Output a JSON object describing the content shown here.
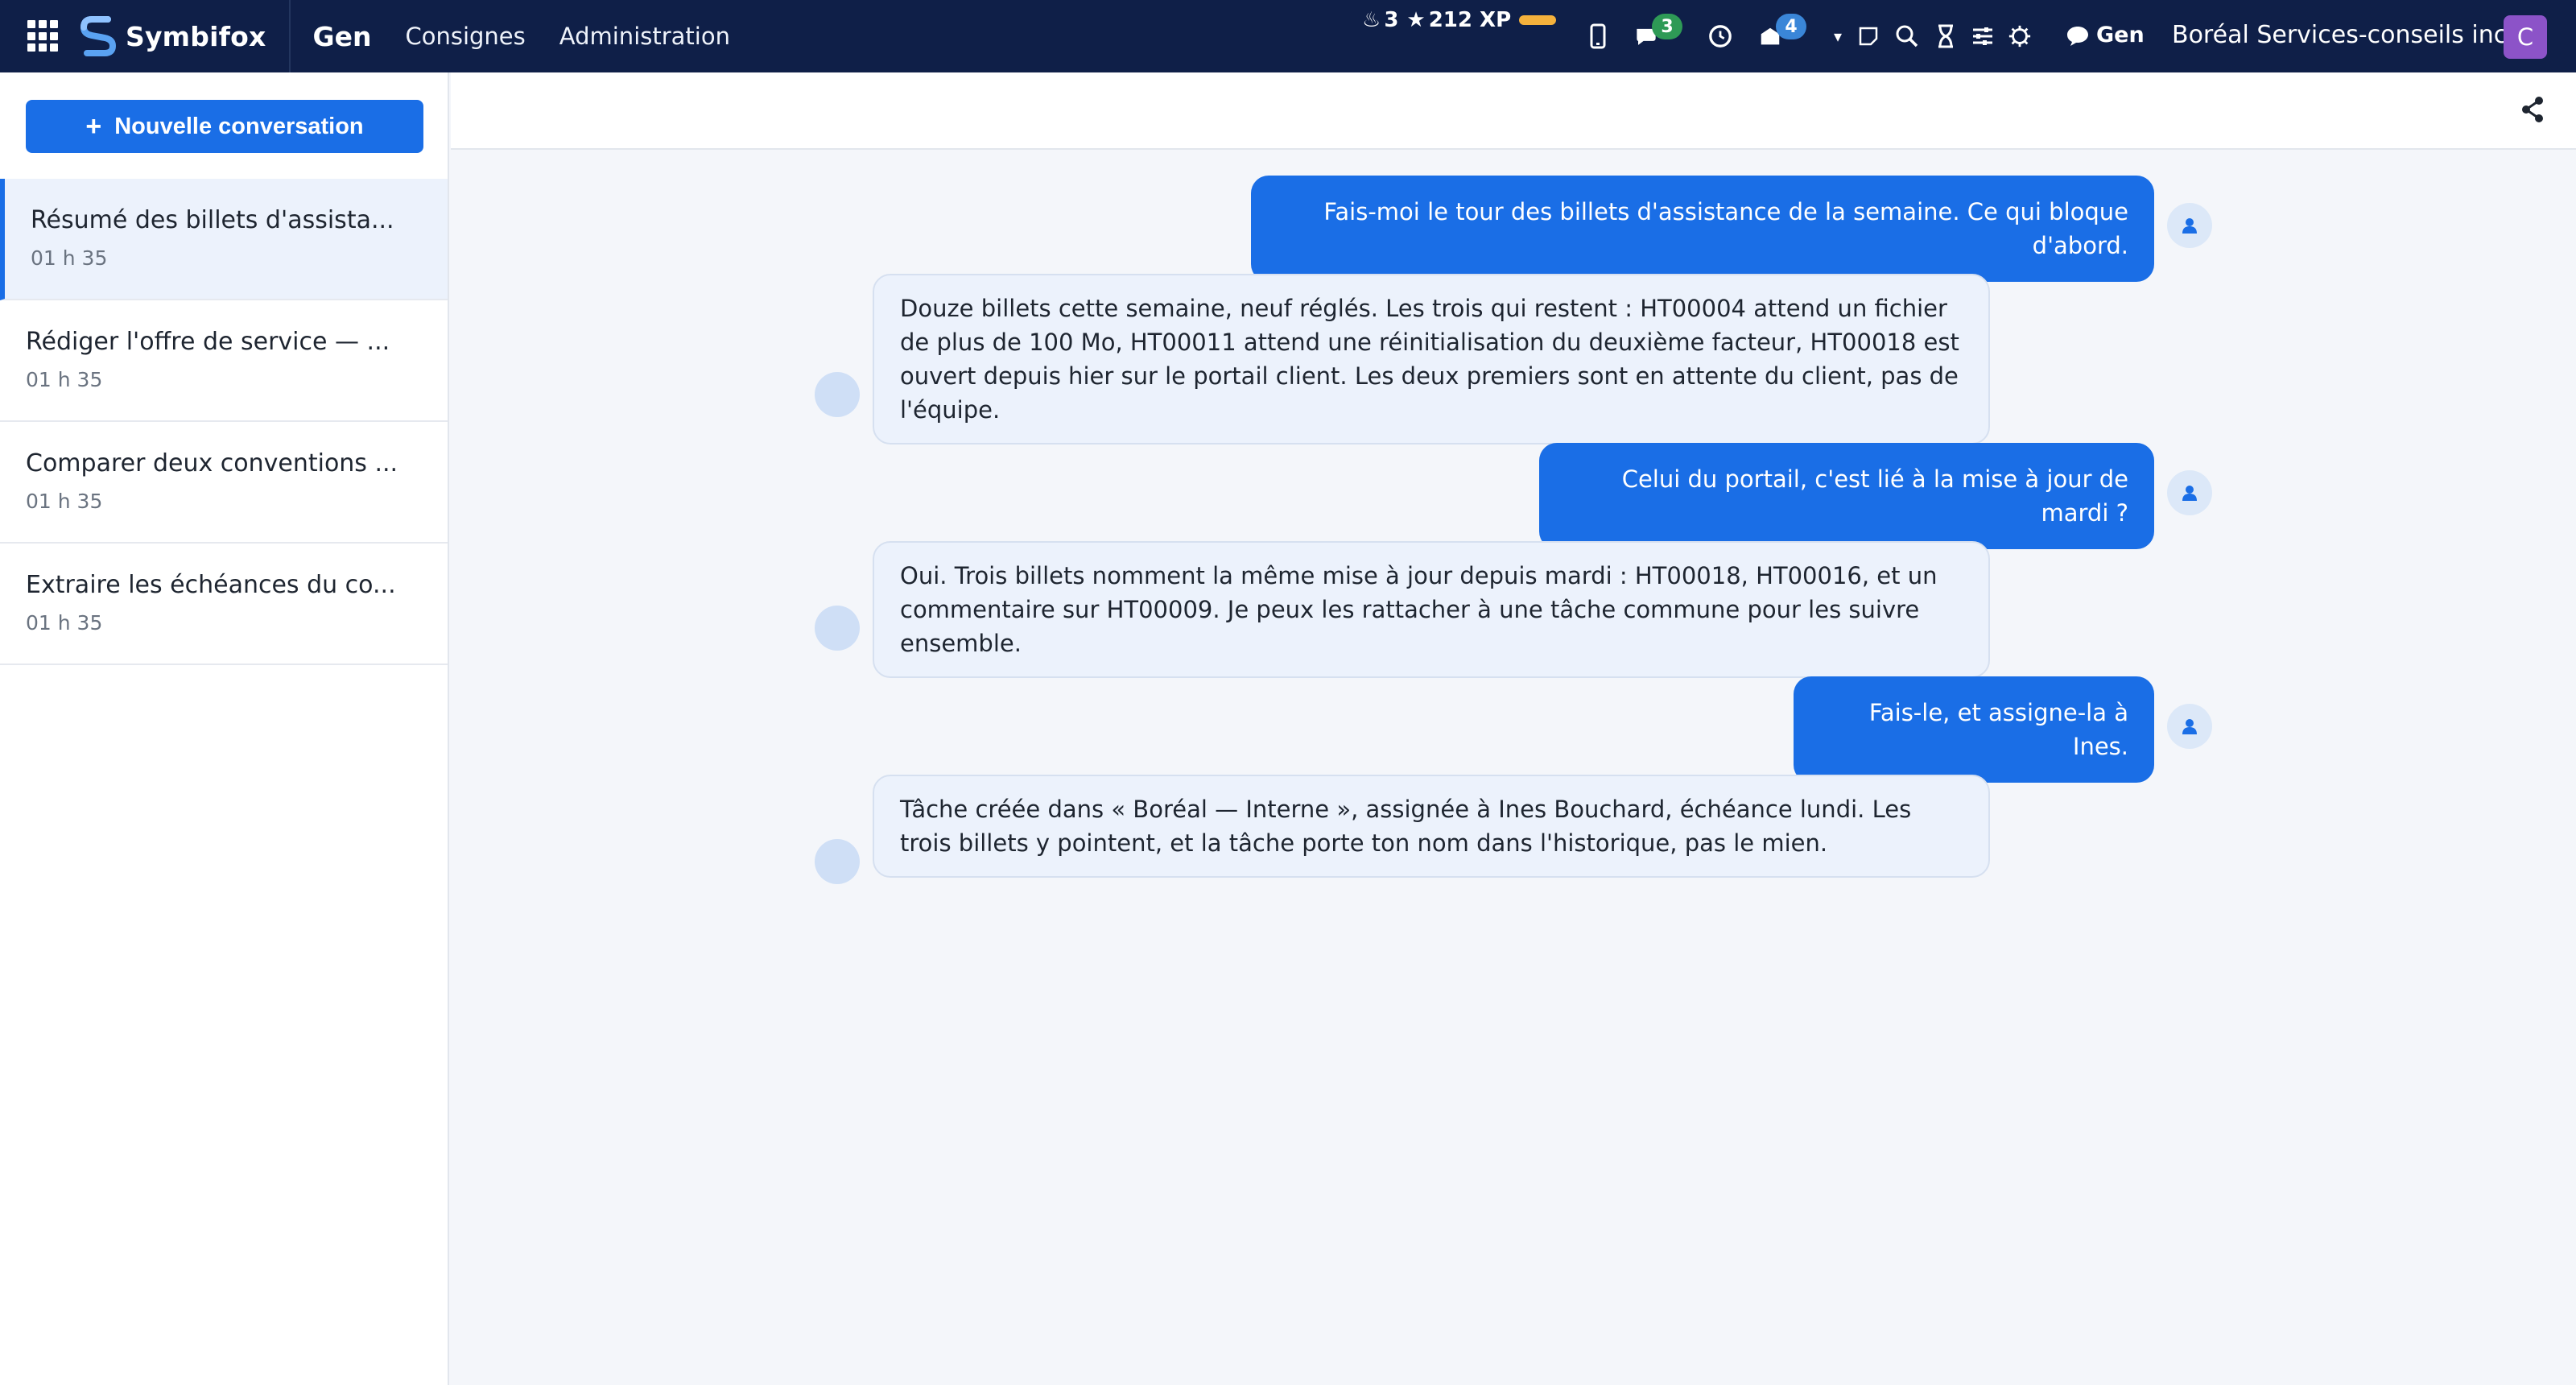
{
  "nav": {
    "brand": "Symbifox",
    "app": "Gen",
    "links": [
      "Consignes",
      "Administration"
    ],
    "streak": "3",
    "xp": "212 XP",
    "badges": {
      "chat": "3",
      "activity": "4"
    },
    "gen_chat": "Gen",
    "company": "Boréal Services-conseils inc.",
    "avatar_letter": "C"
  },
  "sidebar": {
    "new_button": "Nouvelle conversation",
    "items": [
      {
        "title": "Résumé des billets d'assista...",
        "time": "01 h 35"
      },
      {
        "title": "Rédiger l'offre de service — ...",
        "time": "01 h 35"
      },
      {
        "title": "Comparer deux conventions ...",
        "time": "01 h 35"
      },
      {
        "title": "Extraire les échéances du co...",
        "time": "01 h 35"
      }
    ]
  },
  "messages": [
    {
      "role": "user",
      "text": "Fais-moi le tour des billets d'assistance de la semaine. Ce qui bloque d'abord."
    },
    {
      "role": "assistant",
      "text": "Douze billets cette semaine, neuf réglés. Les trois qui restent : HT00004 attend un fichier de plus de 100 Mo, HT00011 attend une réinitialisation du deuxième facteur, HT00018 est ouvert depuis hier sur le portail client. Les deux premiers sont en attente du client, pas de l'équipe."
    },
    {
      "role": "user",
      "text": "Celui du portail, c'est lié à la mise à jour de mardi ?"
    },
    {
      "role": "assistant",
      "text": "Oui. Trois billets nomment la même mise à jour depuis mardi : HT00018, HT00016, et un commentaire sur HT00009. Je peux les rattacher à une tâche commune pour les suivre ensemble."
    },
    {
      "role": "user",
      "text": "Fais-le, et assigne-la à Ines."
    },
    {
      "role": "assistant",
      "text": "Tâche créée dans « Boréal — Interne », assignée à Ines Bouchard, échéance lundi. Les trois billets y pointent, et la tâche porte ton nom dans l'historique, pas le mien."
    }
  ],
  "colors": {
    "nav_bg": "#0f1f48",
    "accent": "#1a6ee6",
    "bot_bubble": "#ecf2fc"
  }
}
